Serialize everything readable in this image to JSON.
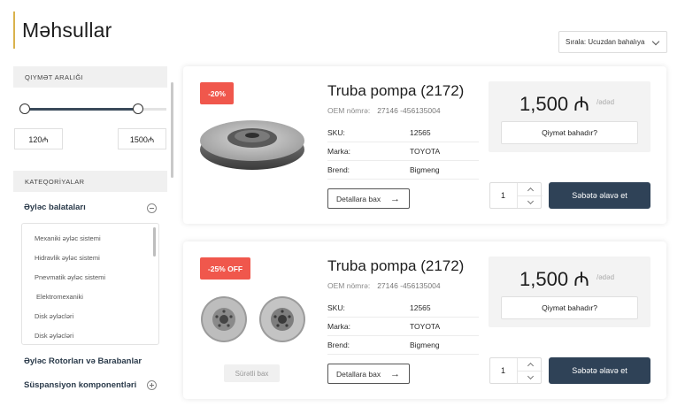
{
  "page": {
    "title": "Məhsullar"
  },
  "sort": {
    "label": "Sırala: Ucuzdan bahalıya"
  },
  "sidebar": {
    "price_range": {
      "title": "QIYMƏT ARALIĞI",
      "min_value": "120₼",
      "max_value": "1500₼"
    },
    "categories_title": "KATEQORİYALAR",
    "categories": [
      {
        "label": "Əyləc balataları",
        "expanded": true,
        "subcategories": [
          "Mexaniki əyləc sistemi",
          "Hidravlik əyləc sistemi",
          "Pnevmatik əyləc sistemi",
          "Elektromexaniki",
          "Disk əyləcləri",
          "Disk əyləcləri"
        ]
      },
      {
        "label": "Əyləc Rotorları və Barabanlar"
      },
      {
        "label": "Süspansiyon komponentləri"
      }
    ]
  },
  "products": [
    {
      "badge": "-20%",
      "title": "Truba pompa (2172)",
      "oem_label": "OEM nömrə:",
      "oem_value": "27146 -456135004",
      "specs": [
        {
          "label": "SKU:",
          "value": "12565"
        },
        {
          "label": "Marka:",
          "value": "TOYOTA"
        },
        {
          "label": "Brend:",
          "value": "Bigmeng"
        }
      ],
      "details_label": "Detallara bax",
      "price": "1,500 ₼",
      "price_unit": "/ədəd",
      "price_ask": "Qiymət bahadır?",
      "quantity": "1",
      "cart_label": "Səbətə əlavə et"
    },
    {
      "badge": "-25% OFF",
      "title": "Truba pompa (2172)",
      "oem_label": "OEM nömrə:",
      "oem_value": "27146 -456135004",
      "specs": [
        {
          "label": "SKU:",
          "value": "12565"
        },
        {
          "label": "Marka:",
          "value": "TOYOTA"
        },
        {
          "label": "Brend:",
          "value": "Bigmeng"
        }
      ],
      "details_label": "Detallara bax",
      "fast_view_label": "Sürətli bax",
      "price": "1,500 ₼",
      "price_unit": "/ədəd",
      "price_ask": "Qiymət bahadır?",
      "quantity": "1",
      "cart_label": "Səbətə əlavə et"
    }
  ],
  "colors": {
    "accent_line": "#d9b24c",
    "badge": "#f0574c",
    "cart_button": "#2f4257"
  },
  "icons": {
    "arrow": "arrow-right-icon",
    "dropdown": "chevron-down-icon",
    "collapse": "minus-circle-icon",
    "expand": "plus-circle-icon"
  }
}
